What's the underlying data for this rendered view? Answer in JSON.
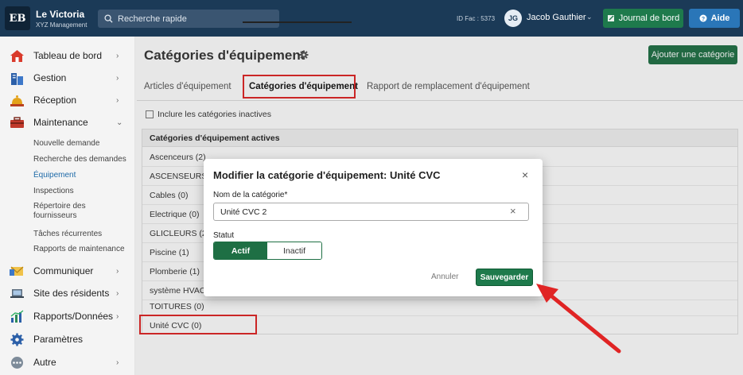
{
  "header": {
    "logo_text": "EB",
    "brand_name": "Le Victoria",
    "brand_sub": "XYZ Management",
    "search_placeholder": "Recherche rapide",
    "id_fac": "ID Fac : 5373",
    "avatar_initials": "JG",
    "user_name": "Jacob Gauthier",
    "journal_label": "Journal de bord",
    "aide_label": "Aide"
  },
  "sidebar": {
    "items": [
      {
        "label": "Tableau de bord",
        "icon": "house-icon"
      },
      {
        "label": "Gestion",
        "icon": "building-icon"
      },
      {
        "label": "Réception",
        "icon": "bell-icon"
      },
      {
        "label": "Maintenance",
        "icon": "toolbox-icon"
      },
      {
        "label": "Communiquer",
        "icon": "envelope-icon"
      },
      {
        "label": "Site des résidents",
        "icon": "laptop-icon"
      },
      {
        "label": "Rapports/Données",
        "icon": "chart-icon"
      },
      {
        "label": "Paramètres",
        "icon": "gear-icon"
      },
      {
        "label": "Autre",
        "icon": "more-icon"
      }
    ],
    "subitems": [
      "Nouvelle demande",
      "Recherche des demandes",
      "Équipement",
      "Inspections",
      "Répertoire des fournisseurs",
      "Tâches récurrentes",
      "Rapports de maintenance"
    ]
  },
  "main": {
    "title": "Catégories d'équipement",
    "add_button": "Ajouter une catégorie",
    "tabs": [
      {
        "label": "Articles d'équipement"
      },
      {
        "label": "Catégories d'équipement"
      },
      {
        "label": "Rapport de remplacement d'équipement"
      }
    ],
    "checkbox_label": "Inclure les catégories inactives",
    "panel_header": "Catégories d'équipement actives",
    "rows": [
      "Ascenceurs (2)",
      "ASCENSEURS (",
      "Cables (0)",
      "Electrique (0)",
      "GLICLEURS (2)",
      "Piscine (1)",
      "Plomberie (1)",
      "système HVAC (",
      "TOITURES (0)",
      "Unité CVC (0)"
    ]
  },
  "modal": {
    "title": "Modifier la catégorie d'équipement: Unité CVC",
    "close": "×",
    "name_label": "Nom de la catégorie*",
    "name_value": "Unité CVC 2",
    "clear": "×",
    "status_label": "Statut",
    "active_label": "Actif",
    "inactive_label": "Inactif",
    "cancel_label": "Annuler",
    "save_label": "Sauvegarder"
  },
  "colors": {
    "topbar": "#1b3a57",
    "primary_green": "#1e7a4c",
    "help_blue": "#2a76b8",
    "highlight_red": "#e02424"
  }
}
